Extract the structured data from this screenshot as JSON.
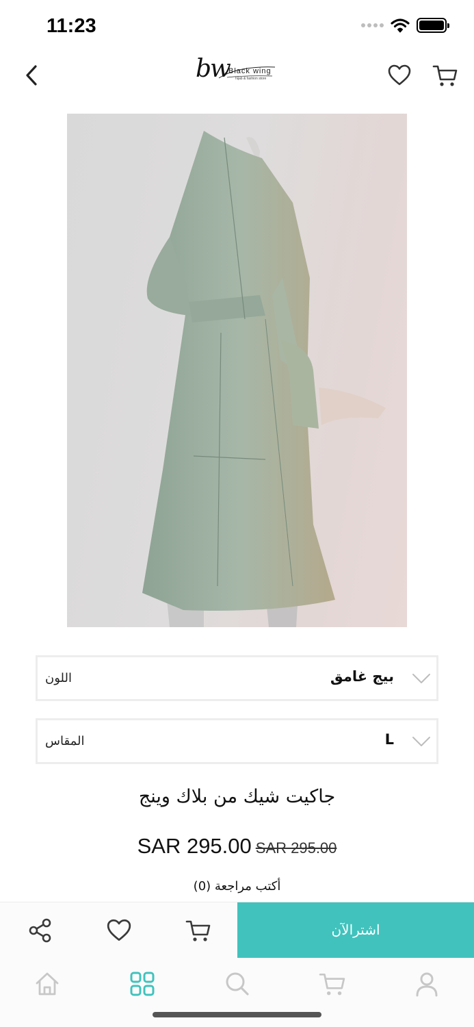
{
  "status_bar": {
    "time": "11:23"
  },
  "header": {
    "logo_mark": "bw",
    "logo_brand": "Black wing",
    "logo_tagline": "hijab & fashion store"
  },
  "product": {
    "image_alt": "جاكيت شيك من بلاك وينج",
    "color_label": "اللون",
    "color_value": "بيج غامق",
    "size_label": "المقاس",
    "size_value": "L",
    "title": "جاكيت شيك من بلاك وينج",
    "price": "SAR 295.00",
    "original_price": "SAR 295.00",
    "review_link": "أكتب مراجعة (0)"
  },
  "actions": {
    "buy_now_label": "اشترالآن"
  },
  "colors": {
    "accent": "#41c2bd",
    "icon_gray": "#c7c7c7",
    "icon_dark": "#3a3a3a"
  },
  "tab_bar": {
    "active": "categories",
    "items": [
      "home-icon",
      "categories-icon",
      "search-icon",
      "cart-icon",
      "account-icon"
    ]
  }
}
